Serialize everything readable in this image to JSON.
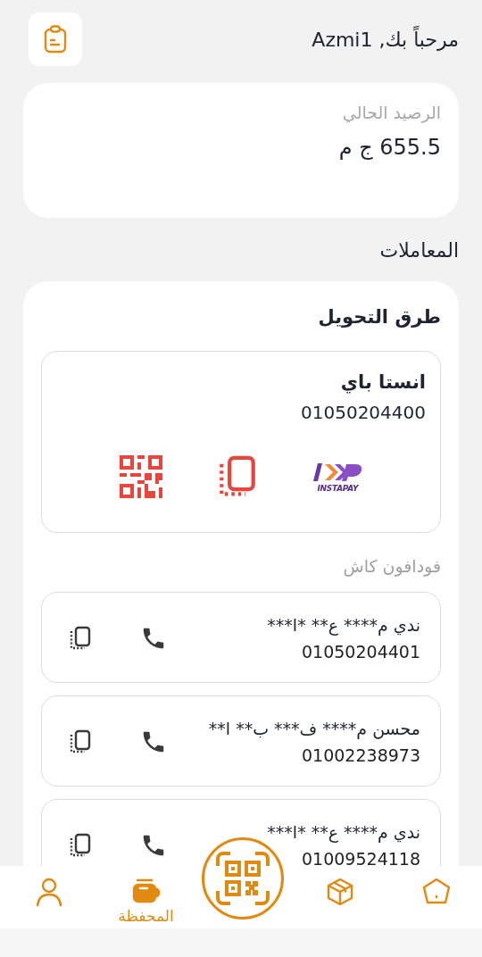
{
  "header": {
    "greeting": "مرحباً بك, Azmi1"
  },
  "balance": {
    "label": "الرصيد الحالي",
    "amount": "655.5 ج م"
  },
  "transactions_title": "المعاملات",
  "transfer_methods": {
    "title": "طرق التحويل",
    "instapay": {
      "name": "انستا باي",
      "number": "01050204400",
      "logo_text": "INSTAPAY"
    },
    "section_title": "فودافون كاش",
    "accounts": [
      {
        "name": "ندي م**** ع** *ا***",
        "number": "01050204401"
      },
      {
        "name": "محسن م**** ف*** ب** ا**",
        "number": "01002238973"
      },
      {
        "name": "ندي م**** ع** *ا***",
        "number": "01009524118"
      }
    ]
  },
  "bottom_nav": [
    {
      "kind": "home",
      "selected": false
    },
    {
      "kind": "box",
      "selected": false
    },
    {
      "kind": "scan",
      "selected": false
    },
    {
      "kind": "wallet",
      "selected": true,
      "label": "المحفظة"
    },
    {
      "kind": "profile",
      "selected": false
    }
  ]
}
